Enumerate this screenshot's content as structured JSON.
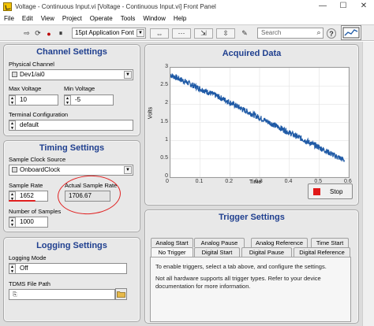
{
  "window": {
    "title": "Voltage - Continuous Input.vi [Voltage - Continuous Input.vi] Front Panel",
    "minimize": "—",
    "maximize": "☐",
    "close": "✕"
  },
  "menu": [
    "File",
    "Edit",
    "View",
    "Project",
    "Operate",
    "Tools",
    "Window",
    "Help"
  ],
  "toolbar": {
    "run": "⇨",
    "run_continuous": "⟳",
    "abort": "●",
    "pause": "⏸",
    "font": "15pt Application Font",
    "align": "⇔",
    "distribute": "⋯",
    "resize": "⇲",
    "reorder": "⇳",
    "search_placeholder": "Search",
    "search_icon": "⌕",
    "help_icon": "?"
  },
  "channel_settings": {
    "title": "Channel Settings",
    "physical_channel_label": "Physical Channel",
    "physical_channel_value": "Dev1/ai0",
    "max_voltage_label": "Max Voltage",
    "max_voltage_value": "10",
    "min_voltage_label": "Min Voltage",
    "min_voltage_value": "-5",
    "terminal_config_label": "Terminal Configuration",
    "terminal_config_value": "default"
  },
  "timing_settings": {
    "title": "Timing Settings",
    "clock_source_label": "Sample Clock Source",
    "clock_source_value": "OnboardClock",
    "sample_rate_label": "Sample Rate",
    "sample_rate_value": "1652",
    "actual_rate_label": "Actual Sample Rate",
    "actual_rate_value": "1706.67",
    "num_samples_label": "Number of Samples",
    "num_samples_value": "1000"
  },
  "logging_settings": {
    "title": "Logging Settings",
    "mode_label": "Logging Mode",
    "mode_value": "Off",
    "path_label": "TDMS File Path",
    "path_value": "",
    "browse_icon": "folder-icon"
  },
  "graph_panel": {
    "stop_label": "Stop",
    "stop_color": "#e01818"
  },
  "trigger_settings": {
    "title": "Trigger Settings",
    "tabs_row1": [
      "Analog Start",
      "Analog Pause",
      "Analog Reference",
      "Time Start"
    ],
    "tabs_row2": [
      "No Trigger",
      "Digital Start",
      "Digital Pause",
      "Digital Reference"
    ],
    "active_tab": "No Trigger",
    "text1": "To enable triggers, select a tab above, and configure the settings.",
    "text2": "Not all hardware supports all trigger types. Refer to your device documentation for more information."
  },
  "chart_data": {
    "type": "line",
    "title": "Acquired Data",
    "xlabel": "Time",
    "ylabel": "Volts",
    "xlim": [
      0,
      0.6
    ],
    "ylim": [
      0,
      3
    ],
    "xticks": [
      "0",
      "0.1",
      "0.2",
      "0.3",
      "0.4",
      "0.5",
      "0.6"
    ],
    "yticks": [
      "0",
      "0.5",
      "1",
      "1.5",
      "2",
      "2.5",
      "3"
    ],
    "grid": true,
    "line_color": "#1f5aa6",
    "series": [
      {
        "x": [
          0,
          0.05,
          0.1,
          0.15,
          0.2,
          0.25,
          0.3,
          0.35,
          0.4,
          0.45,
          0.5,
          0.55,
          0.585
        ],
        "values": [
          2.8,
          2.62,
          2.42,
          2.25,
          2.05,
          1.83,
          1.63,
          1.43,
          1.22,
          1.02,
          0.82,
          0.6,
          0.47
        ]
      }
    ]
  }
}
